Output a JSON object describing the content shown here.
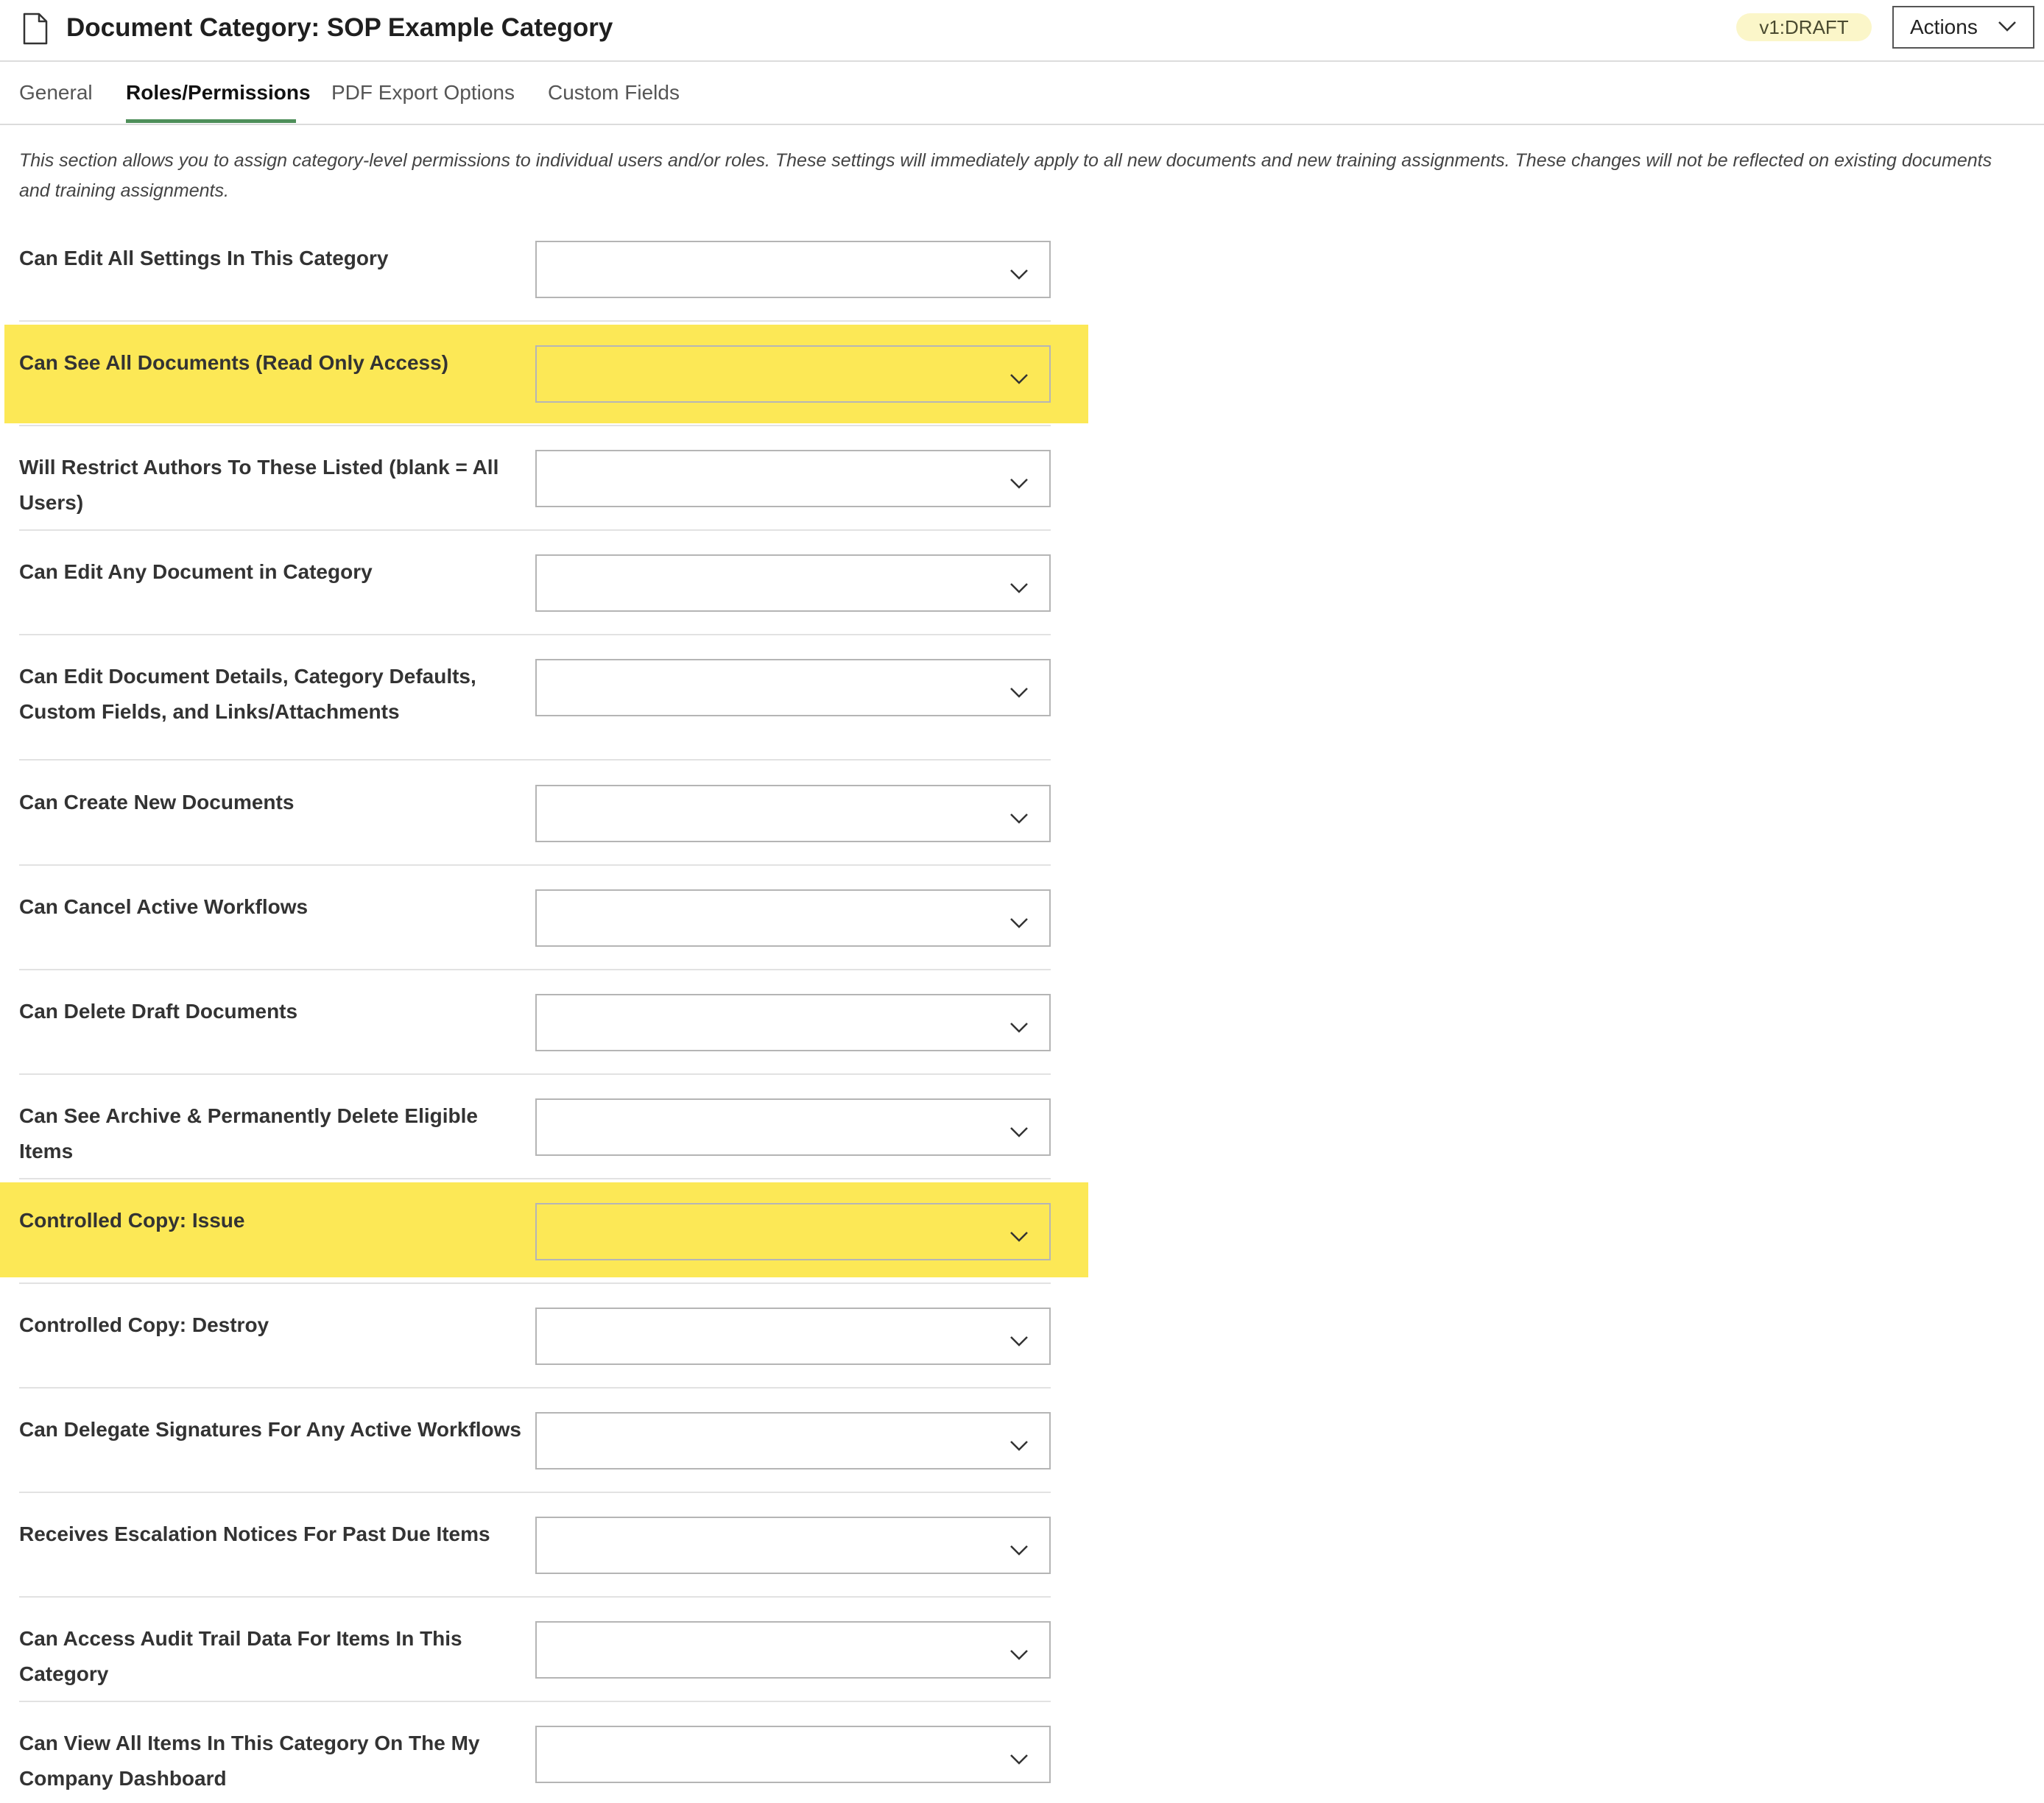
{
  "header": {
    "icon": "document-icon",
    "title": "Document Category: SOP Example Category",
    "version_badge": "v1:DRAFT",
    "actions_label": "Actions",
    "actions_icon": "chevron-down-icon"
  },
  "tabs": [
    {
      "label": "General",
      "active": false
    },
    {
      "label": "Roles/Permissions",
      "active": true
    },
    {
      "label": "PDF Export Options",
      "active": false
    },
    {
      "label": "Custom Fields",
      "active": false
    }
  ],
  "intro": "This section allows you to assign category-level permissions to individual users and/or roles. These settings will immediately apply to all new documents and new training assignments. These changes will not be reflected on existing documents and training assignments.",
  "permissions": [
    {
      "label": "Can Edit All Settings In This Category",
      "value": "",
      "highlighted": false
    },
    {
      "label": "Can See All Documents (Read Only Access)",
      "value": "",
      "highlighted": true
    },
    {
      "label": "Will Restrict Authors To These Listed (blank = All Users)",
      "value": "",
      "highlighted": false
    },
    {
      "label": "Can Edit Any Document in Category",
      "value": "",
      "highlighted": false
    },
    {
      "label": "Can Edit Document Details, Category Defaults, Custom Fields, and Links/Attachments",
      "value": "",
      "highlighted": false
    },
    {
      "label": "Can Create New Documents",
      "value": "",
      "highlighted": false
    },
    {
      "label": "Can Cancel Active Workflows",
      "value": "",
      "highlighted": false
    },
    {
      "label": "Can Delete Draft Documents",
      "value": "",
      "highlighted": false
    },
    {
      "label": "Can See Archive & Permanently Delete Eligible Items",
      "value": "",
      "highlighted": false
    },
    {
      "label": "Controlled Copy: Issue",
      "value": "",
      "highlighted": true
    },
    {
      "label": "Controlled Copy: Destroy",
      "value": "",
      "highlighted": false
    },
    {
      "label": "Can Delegate Signatures For Any Active Workflows",
      "value": "",
      "highlighted": false
    },
    {
      "label": "Receives Escalation Notices For Past Due Items",
      "value": "",
      "highlighted": false
    },
    {
      "label": "Can Access Audit Trail Data For Items In This Category",
      "value": "",
      "highlighted": false
    },
    {
      "label": "Can View All Items In This Category On The My Company Dashboard",
      "value": "",
      "highlighted": false
    }
  ],
  "colors": {
    "highlight": "#fce856",
    "active_tab_underline": "#4e8f5a",
    "version_badge_bg": "#fbf6c9"
  }
}
